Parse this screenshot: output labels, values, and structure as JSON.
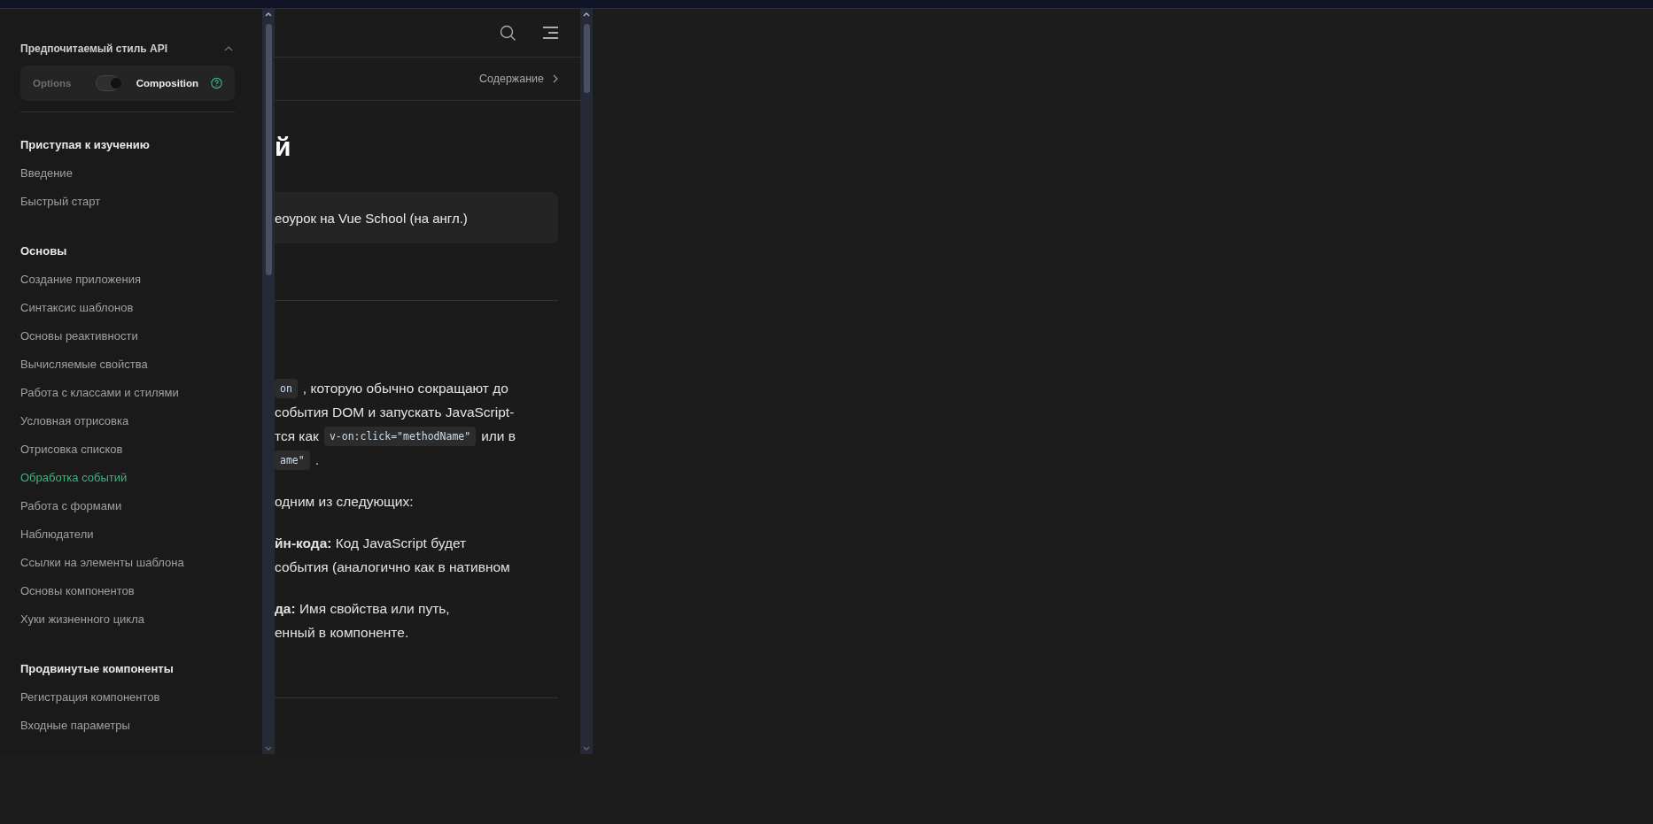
{
  "sidebar": {
    "api_style": {
      "title": "Предпочитаемый стиль API",
      "expanded": true,
      "options_label": "Options",
      "composition_label": "Composition",
      "composition": true
    },
    "groups": [
      {
        "title": "Приступая к изучению",
        "items": [
          {
            "label": "Введение",
            "selected": false
          },
          {
            "label": "Быстрый старт",
            "selected": false
          }
        ]
      },
      {
        "title": "Основы",
        "items": [
          {
            "label": "Создание приложения",
            "selected": false
          },
          {
            "label": "Синтаксис шаблонов",
            "selected": false
          },
          {
            "label": "Основы реактивности",
            "selected": false
          },
          {
            "label": "Вычисляемые свойства",
            "selected": false
          },
          {
            "label": "Работа с классами и стилями",
            "selected": false
          },
          {
            "label": "Условная отрисовка",
            "selected": false
          },
          {
            "label": "Отрисовка списков",
            "selected": false
          },
          {
            "label": "Обработка событий",
            "selected": true
          },
          {
            "label": "Работа с формами",
            "selected": false
          },
          {
            "label": "Наблюдатели",
            "selected": false
          },
          {
            "label": "Ссылки на элементы шаблона",
            "selected": false
          },
          {
            "label": "Основы компонентов",
            "selected": false
          },
          {
            "label": "Хуки жизненного цикла",
            "selected": false
          }
        ]
      },
      {
        "title": "Продвинутые компоненты",
        "items": [
          {
            "label": "Регистрация компонентов",
            "selected": false
          },
          {
            "label": "Входные параметры",
            "selected": false
          }
        ]
      }
    ]
  },
  "content": {
    "outline_button": "Содержание",
    "title_fragment": "й",
    "callout": "еоурок на Vue School (на англ.)",
    "paragraphs": [
      [
        [
          {
            "kind": "code",
            "text": "on"
          },
          {
            "kind": "text",
            "text": ", которую обычно сокращают до"
          }
        ],
        [
          {
            "kind": "text",
            "text": "события DOM и запускать JavaScript-"
          }
        ],
        [
          {
            "kind": "text",
            "text": "тся как"
          },
          {
            "kind": "code",
            "text": "v-on:click=\"methodName\""
          },
          {
            "kind": "text",
            "text": "или в"
          }
        ],
        [
          {
            "kind": "code",
            "text": "ame\""
          },
          {
            "kind": "text",
            "text": "."
          }
        ]
      ],
      [
        [
          {
            "kind": "text",
            "text": "одним из следующих:"
          }
        ]
      ],
      [
        [
          {
            "kind": "text",
            "text": "**йн-кода:** Код JavaScript будет"
          }
        ],
        [
          {
            "kind": "text",
            "text": "события (аналогично как в нативном"
          }
        ]
      ],
      [
        [
          {
            "kind": "text",
            "text": "**да:** Имя свойства или путь,"
          }
        ],
        [
          {
            "kind": "text",
            "text": "енный в компоненте."
          }
        ]
      ]
    ]
  }
}
